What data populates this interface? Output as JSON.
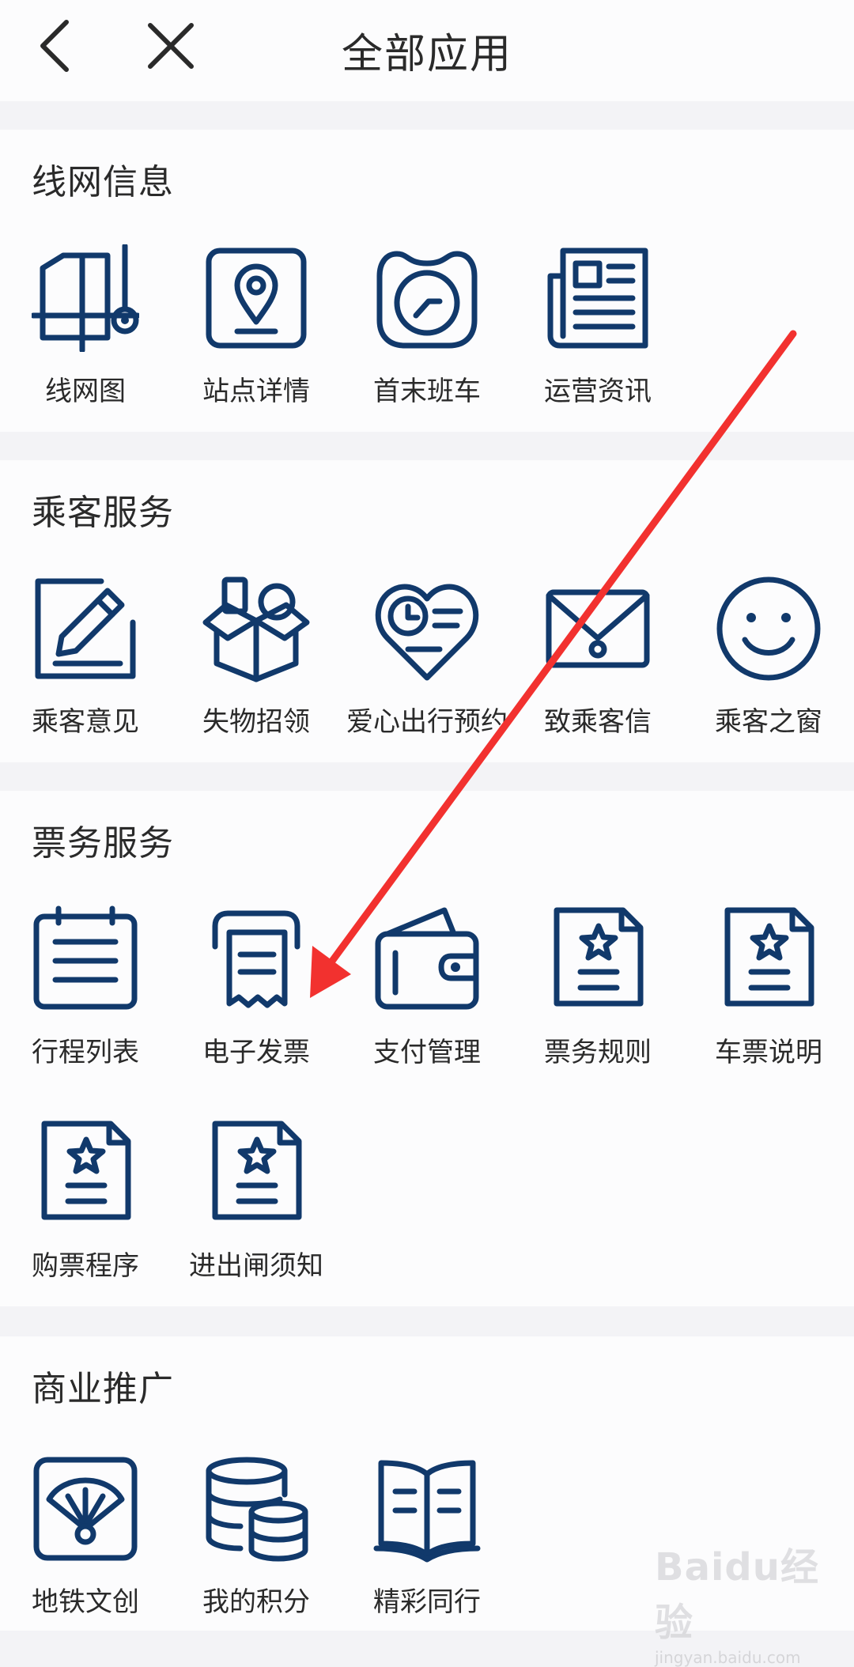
{
  "header": {
    "title": "全部应用"
  },
  "sections": [
    {
      "title": "线网信息",
      "items": [
        {
          "label": "线网图",
          "icon": "network-map-icon"
        },
        {
          "label": "站点详情",
          "icon": "station-pin-icon"
        },
        {
          "label": "首末班车",
          "icon": "clock-icon"
        },
        {
          "label": "运营资讯",
          "icon": "newspaper-icon"
        }
      ]
    },
    {
      "title": "乘客服务",
      "items": [
        {
          "label": "乘客意见",
          "icon": "edit-icon"
        },
        {
          "label": "失物招领",
          "icon": "box-icon"
        },
        {
          "label": "爱心出行预约",
          "icon": "heart-clock-icon"
        },
        {
          "label": "致乘客信",
          "icon": "envelope-icon"
        },
        {
          "label": "乘客之窗",
          "icon": "smiley-icon"
        }
      ]
    },
    {
      "title": "票务服务",
      "items": [
        {
          "label": "行程列表",
          "icon": "calendar-list-icon"
        },
        {
          "label": "电子发票",
          "icon": "receipt-icon"
        },
        {
          "label": "支付管理",
          "icon": "wallet-icon"
        },
        {
          "label": "票务规则",
          "icon": "star-document-icon"
        },
        {
          "label": "车票说明",
          "icon": "star-document-icon"
        },
        {
          "label": "购票程序",
          "icon": "star-document-icon"
        },
        {
          "label": "进出闸须知",
          "icon": "star-document-icon"
        }
      ]
    },
    {
      "title": "商业推广",
      "items": [
        {
          "label": "地铁文创",
          "icon": "fan-icon"
        },
        {
          "label": "我的积分",
          "icon": "database-icon"
        },
        {
          "label": "精彩同行",
          "icon": "book-icon"
        }
      ]
    }
  ],
  "watermark": {
    "line1": "Baidu经验",
    "line2": "jingyan.baidu.com"
  },
  "colors": {
    "icon": "#11396b",
    "arrow": "#f2312f",
    "background": "#f3f3f6",
    "card": "#fcfcfd"
  }
}
